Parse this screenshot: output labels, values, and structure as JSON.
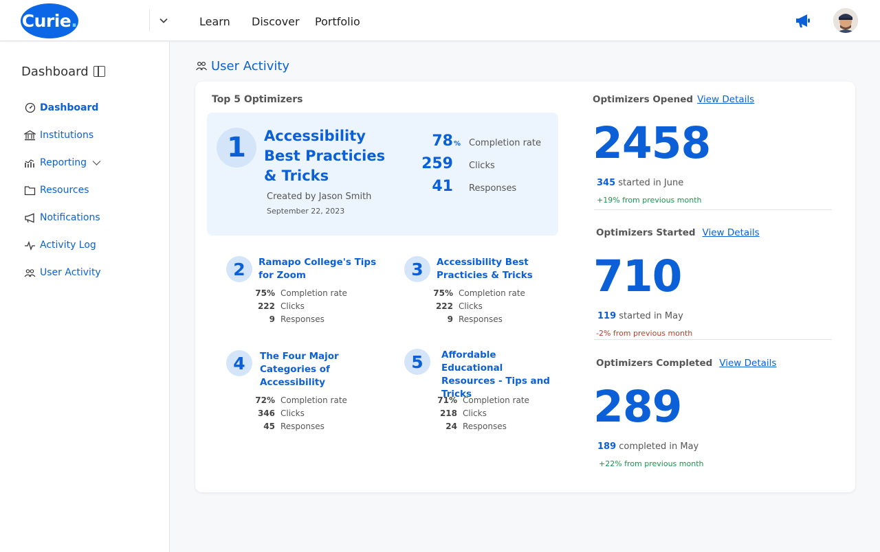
{
  "app": {
    "logo_text": "Curie",
    "logo_dot": "."
  },
  "topnav": {
    "items": [
      "Learn",
      "Discover",
      "Portfolio"
    ]
  },
  "sidebar": {
    "title": "Dashboard",
    "items": [
      {
        "label": "Dashboard",
        "icon": "dashboard-gauge-icon",
        "active": true
      },
      {
        "label": "Institutions",
        "icon": "institution-icon"
      },
      {
        "label": "Reporting",
        "icon": "chart-icon"
      },
      {
        "label": "Resources",
        "icon": "folder-icon"
      },
      {
        "label": "Notifications",
        "icon": "megaphone-icon"
      },
      {
        "label": "Activity Log",
        "icon": "pulse-icon"
      },
      {
        "label": "User Activity",
        "icon": "users-icon"
      }
    ]
  },
  "main": {
    "section_title": "User Activity",
    "top5_label": "Top 5 Optimizers",
    "featured": {
      "rank": "1",
      "title": "Accessibility Best Practicies & Tricks",
      "created_by": "Created by Jason Smith",
      "date": "September 22, 2023",
      "stats": [
        {
          "value": "78",
          "suffix": "%",
          "label": "Completion rate"
        },
        {
          "value": "259",
          "suffix": "",
          "label": "Clicks"
        },
        {
          "value": "41",
          "suffix": "",
          "label": "Responses"
        }
      ]
    },
    "optimizers": [
      {
        "rank": "2",
        "title": "Ramapo College's Tips for Zoom",
        "stats": [
          {
            "value": "75%",
            "label": "Completion rate"
          },
          {
            "value": "222",
            "label": "Clicks"
          },
          {
            "value": "9",
            "label": "Responses"
          }
        ]
      },
      {
        "rank": "3",
        "title": "Accessibility Best Practicies & Tricks",
        "stats": [
          {
            "value": "75%",
            "label": "Completion rate"
          },
          {
            "value": "222",
            "label": "Clicks"
          },
          {
            "value": "9",
            "label": "Responses"
          }
        ]
      },
      {
        "rank": "4",
        "title": "The Four Major Categories of Accessibility",
        "stats": [
          {
            "value": "72%",
            "label": "Completion rate"
          },
          {
            "value": "346",
            "label": "Clicks"
          },
          {
            "value": "45",
            "label": "Responses"
          }
        ]
      },
      {
        "rank": "5",
        "title": "Affordable Educational Resources - Tips and Tricks",
        "stats": [
          {
            "value": "71%",
            "label": "Completion rate"
          },
          {
            "value": "218",
            "label": "Clicks"
          },
          {
            "value": "24",
            "label": "Responses"
          }
        ]
      }
    ],
    "metrics": [
      {
        "title": "Optimizers Opened",
        "link": "View Details",
        "value": "2458",
        "sub_value": "345",
        "sub_text": "started in June",
        "delta": "+19% from previous month",
        "trend": "up"
      },
      {
        "title": "Optimizers Started",
        "link": "View Details",
        "value": "710",
        "sub_value": "119",
        "sub_text": "started in May",
        "delta": "-2% from previous month",
        "trend": "down"
      },
      {
        "title": "Optimizers Completed",
        "link": "View Details",
        "value": "289",
        "sub_value": "189",
        "sub_text": "completed in May",
        "delta": "+22% from previous month",
        "trend": "up"
      }
    ]
  },
  "colors": {
    "brand": "#0b67e6",
    "link": "#0b5fd7",
    "positive": "#17944a",
    "negative": "#c0392b",
    "feature_bg": "#ecf4fd"
  }
}
